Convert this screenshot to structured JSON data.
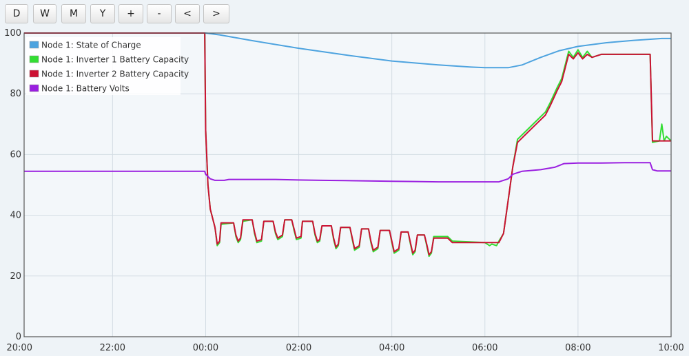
{
  "toolbar": {
    "buttons": [
      {
        "label": "D"
      },
      {
        "label": "W"
      },
      {
        "label": "M"
      },
      {
        "label": "Y"
      },
      {
        "label": "+"
      },
      {
        "label": "-"
      },
      {
        "label": "<"
      },
      {
        "label": ">"
      }
    ]
  },
  "chart_data": {
    "type": "line",
    "title": "",
    "xlabel": "",
    "ylabel": "",
    "x_unit": "hours relative to 00:00",
    "xlim": [
      -3.9,
      10.0
    ],
    "ylim": [
      0,
      100
    ],
    "x_ticks": [
      {
        "value": -4,
        "label": "20:00"
      },
      {
        "value": -2,
        "label": "22:00"
      },
      {
        "value": 0,
        "label": "00:00"
      },
      {
        "value": 2,
        "label": "02:00"
      },
      {
        "value": 4,
        "label": "04:00"
      },
      {
        "value": 6,
        "label": "06:00"
      },
      {
        "value": 8,
        "label": "08:00"
      },
      {
        "value": 10,
        "label": "10:00"
      }
    ],
    "y_ticks": [
      0,
      20,
      40,
      60,
      80,
      100
    ],
    "grid": true,
    "legend_position": "top-left",
    "series": [
      {
        "name": "Node 1: State of Charge",
        "color": "#4da3df",
        "points": [
          [
            -3.9,
            100
          ],
          [
            0.0,
            100
          ],
          [
            0.3,
            99.4
          ],
          [
            1.0,
            97.5
          ],
          [
            2.0,
            95
          ],
          [
            3.0,
            92.8
          ],
          [
            4.0,
            90.8
          ],
          [
            5.0,
            89.5
          ],
          [
            5.7,
            88.8
          ],
          [
            6.0,
            88.6
          ],
          [
            6.5,
            88.6
          ],
          [
            6.8,
            89.5
          ],
          [
            7.2,
            92
          ],
          [
            7.6,
            94.2
          ],
          [
            8.0,
            95.6
          ],
          [
            8.6,
            96.8
          ],
          [
            9.2,
            97.6
          ],
          [
            9.8,
            98.2
          ],
          [
            10.0,
            98.2
          ]
        ]
      },
      {
        "name": "Node 1: Inverter 1 Battery Capacity",
        "color": "#33dd33",
        "points": [
          [
            -3.9,
            100
          ],
          [
            -0.02,
            100
          ],
          [
            0.0,
            68
          ],
          [
            0.05,
            50
          ],
          [
            0.1,
            42
          ],
          [
            0.2,
            36
          ],
          [
            0.25,
            30
          ],
          [
            0.3,
            31
          ],
          [
            0.33,
            37
          ],
          [
            0.6,
            37.5
          ],
          [
            0.65,
            33
          ],
          [
            0.7,
            31
          ],
          [
            0.75,
            32
          ],
          [
            0.8,
            38
          ],
          [
            1.0,
            38.5
          ],
          [
            1.05,
            34
          ],
          [
            1.1,
            31
          ],
          [
            1.2,
            31.5
          ],
          [
            1.25,
            38
          ],
          [
            1.45,
            38
          ],
          [
            1.5,
            34
          ],
          [
            1.55,
            32
          ],
          [
            1.65,
            33
          ],
          [
            1.7,
            38.5
          ],
          [
            1.85,
            38.5
          ],
          [
            1.9,
            35
          ],
          [
            1.95,
            32
          ],
          [
            2.05,
            32.5
          ],
          [
            2.08,
            38
          ],
          [
            2.3,
            38
          ],
          [
            2.35,
            33.5
          ],
          [
            2.4,
            31
          ],
          [
            2.45,
            31.5
          ],
          [
            2.5,
            36.5
          ],
          [
            2.7,
            36.5
          ],
          [
            2.75,
            32
          ],
          [
            2.8,
            29
          ],
          [
            2.85,
            30
          ],
          [
            2.9,
            36
          ],
          [
            3.1,
            36
          ],
          [
            3.15,
            32
          ],
          [
            3.2,
            28.5
          ],
          [
            3.3,
            29.5
          ],
          [
            3.35,
            35.5
          ],
          [
            3.5,
            35.5
          ],
          [
            3.55,
            31
          ],
          [
            3.6,
            28
          ],
          [
            3.7,
            29
          ],
          [
            3.75,
            35
          ],
          [
            3.95,
            35
          ],
          [
            4.0,
            31
          ],
          [
            4.05,
            27.5
          ],
          [
            4.15,
            28.5
          ],
          [
            4.2,
            34.5
          ],
          [
            4.35,
            34.5
          ],
          [
            4.4,
            30.5
          ],
          [
            4.45,
            27
          ],
          [
            4.5,
            28
          ],
          [
            4.55,
            33.5
          ],
          [
            4.7,
            33.5
          ],
          [
            4.75,
            30
          ],
          [
            4.8,
            26.5
          ],
          [
            4.85,
            27.5
          ],
          [
            4.9,
            33
          ],
          [
            5.2,
            33
          ],
          [
            5.3,
            31.5
          ],
          [
            6.0,
            31
          ],
          [
            6.1,
            30
          ],
          [
            6.15,
            30.5
          ],
          [
            6.25,
            30
          ],
          [
            6.3,
            31.5
          ],
          [
            6.4,
            34
          ],
          [
            6.5,
            45
          ],
          [
            6.6,
            56
          ],
          [
            6.7,
            65
          ],
          [
            6.9,
            68
          ],
          [
            7.1,
            71
          ],
          [
            7.3,
            74
          ],
          [
            7.4,
            77
          ],
          [
            7.55,
            82
          ],
          [
            7.65,
            85
          ],
          [
            7.75,
            91
          ],
          [
            7.8,
            94
          ],
          [
            7.9,
            92
          ],
          [
            8.0,
            94.5
          ],
          [
            8.1,
            92
          ],
          [
            8.2,
            94
          ],
          [
            8.3,
            92
          ],
          [
            8.5,
            93
          ],
          [
            9.0,
            93
          ],
          [
            9.55,
            93
          ],
          [
            9.6,
            64
          ],
          [
            9.75,
            64.5
          ],
          [
            9.8,
            70
          ],
          [
            9.85,
            64.5
          ],
          [
            9.9,
            66
          ],
          [
            10.0,
            64.5
          ]
        ]
      },
      {
        "name": "Node 1: Inverter 2 Battery Capacity",
        "color": "#cc1133",
        "points": [
          [
            -3.9,
            100
          ],
          [
            -0.02,
            100
          ],
          [
            0.0,
            68
          ],
          [
            0.05,
            50
          ],
          [
            0.1,
            42
          ],
          [
            0.2,
            36
          ],
          [
            0.25,
            30.5
          ],
          [
            0.3,
            31.5
          ],
          [
            0.33,
            37.5
          ],
          [
            0.6,
            37.5
          ],
          [
            0.65,
            33.5
          ],
          [
            0.7,
            31.5
          ],
          [
            0.75,
            32.5
          ],
          [
            0.8,
            38.5
          ],
          [
            1.0,
            38.5
          ],
          [
            1.05,
            34.5
          ],
          [
            1.1,
            31.5
          ],
          [
            1.2,
            32
          ],
          [
            1.25,
            38
          ],
          [
            1.45,
            38
          ],
          [
            1.5,
            34.5
          ],
          [
            1.55,
            32.5
          ],
          [
            1.65,
            33.5
          ],
          [
            1.7,
            38.5
          ],
          [
            1.85,
            38.5
          ],
          [
            1.9,
            35.5
          ],
          [
            1.95,
            32.5
          ],
          [
            2.05,
            33
          ],
          [
            2.08,
            38
          ],
          [
            2.3,
            38
          ],
          [
            2.35,
            34
          ],
          [
            2.4,
            31.5
          ],
          [
            2.45,
            32
          ],
          [
            2.5,
            36.5
          ],
          [
            2.7,
            36.5
          ],
          [
            2.75,
            32.5
          ],
          [
            2.8,
            29.5
          ],
          [
            2.85,
            30.5
          ],
          [
            2.9,
            36
          ],
          [
            3.1,
            36
          ],
          [
            3.15,
            32.5
          ],
          [
            3.2,
            29
          ],
          [
            3.3,
            30
          ],
          [
            3.35,
            35.5
          ],
          [
            3.5,
            35.5
          ],
          [
            3.55,
            31.5
          ],
          [
            3.6,
            28.5
          ],
          [
            3.7,
            29.5
          ],
          [
            3.75,
            35
          ],
          [
            3.95,
            35
          ],
          [
            4.0,
            31.5
          ],
          [
            4.05,
            28
          ],
          [
            4.15,
            29
          ],
          [
            4.2,
            34.5
          ],
          [
            4.35,
            34.5
          ],
          [
            4.4,
            31
          ],
          [
            4.45,
            27.5
          ],
          [
            4.5,
            28.5
          ],
          [
            4.55,
            33.5
          ],
          [
            4.7,
            33.5
          ],
          [
            4.75,
            30.5
          ],
          [
            4.8,
            27
          ],
          [
            4.85,
            28
          ],
          [
            4.9,
            32.5
          ],
          [
            5.2,
            32.5
          ],
          [
            5.3,
            31
          ],
          [
            6.0,
            31
          ],
          [
            6.3,
            31
          ],
          [
            6.4,
            34
          ],
          [
            6.5,
            45
          ],
          [
            6.6,
            56
          ],
          [
            6.7,
            64
          ],
          [
            6.9,
            67
          ],
          [
            7.1,
            70
          ],
          [
            7.3,
            73
          ],
          [
            7.4,
            76
          ],
          [
            7.55,
            81
          ],
          [
            7.65,
            84
          ],
          [
            7.75,
            90
          ],
          [
            7.8,
            93
          ],
          [
            7.9,
            91.5
          ],
          [
            8.0,
            93.5
          ],
          [
            8.1,
            91.5
          ],
          [
            8.2,
            93
          ],
          [
            8.3,
            92
          ],
          [
            8.5,
            93
          ],
          [
            9.0,
            93
          ],
          [
            9.55,
            93
          ],
          [
            9.6,
            64.5
          ],
          [
            10.0,
            64.5
          ]
        ]
      },
      {
        "name": "Node 1: Battery Volts",
        "color": "#9a1fe0",
        "points": [
          [
            -3.9,
            54.5
          ],
          [
            -0.02,
            54.5
          ],
          [
            0.0,
            53.5
          ],
          [
            0.1,
            52
          ],
          [
            0.2,
            51.5
          ],
          [
            0.4,
            51.5
          ],
          [
            0.5,
            51.8
          ],
          [
            1.0,
            51.8
          ],
          [
            1.5,
            51.8
          ],
          [
            2.0,
            51.6
          ],
          [
            2.5,
            51.5
          ],
          [
            3.0,
            51.4
          ],
          [
            3.5,
            51.3
          ],
          [
            4.0,
            51.2
          ],
          [
            4.5,
            51.1
          ],
          [
            5.0,
            51
          ],
          [
            5.5,
            51
          ],
          [
            6.0,
            51
          ],
          [
            6.3,
            51
          ],
          [
            6.5,
            52
          ],
          [
            6.6,
            53.5
          ],
          [
            6.8,
            54.5
          ],
          [
            7.2,
            55
          ],
          [
            7.5,
            55.8
          ],
          [
            7.7,
            57
          ],
          [
            8.0,
            57.2
          ],
          [
            8.5,
            57.2
          ],
          [
            9.0,
            57.3
          ],
          [
            9.55,
            57.3
          ],
          [
            9.6,
            55
          ],
          [
            9.7,
            54.6
          ],
          [
            10.0,
            54.6
          ]
        ]
      }
    ]
  }
}
